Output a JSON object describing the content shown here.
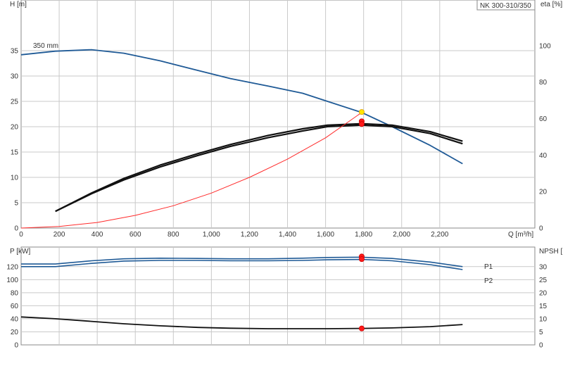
{
  "title_box": "NK 300-310/350",
  "colors": {
    "head": "#1f5a96",
    "eff": "#111111",
    "p": "#1f5a96",
    "npsh": "#111111",
    "system": "#ff2a2a",
    "grid": "#c9c9c9",
    "marker_red": "#ff1a1a",
    "marker_yellow": "#ffe600"
  },
  "chart_data": [
    {
      "type": "line",
      "title": "",
      "xlabel": "Q [m³/h]",
      "ylabel": "H [m]",
      "y2label": "eta [%]",
      "xlim": [
        0,
        2700
      ],
      "ylim": [
        0,
        45
      ],
      "y2lim": [
        0,
        125
      ],
      "x_ticks": [
        0,
        200,
        400,
        600,
        800,
        1000,
        1200,
        1400,
        1600,
        1800,
        2000,
        2200
      ],
      "x_tick_labels": [
        "0",
        "200",
        "400",
        "600",
        "800",
        "1,000",
        "1,200",
        "1,400",
        "1,600",
        "1,800",
        "2,000",
        "2,200"
      ],
      "y_ticks": [
        0,
        5,
        10,
        15,
        20,
        25,
        30,
        35
      ],
      "y2_ticks": [
        0,
        20,
        40,
        60,
        80,
        100
      ],
      "grid": true,
      "annotations": [
        {
          "text": "350 mm",
          "x": 100,
          "y": 36
        }
      ],
      "series": [
        {
          "key": "head",
          "axis": "left",
          "x": [
            0,
            180,
            370,
            540,
            730,
            930,
            1100,
            1300,
            1480,
            1610,
            1790,
            1950,
            2150,
            2320
          ],
          "y": [
            34.2,
            34.9,
            35.2,
            34.5,
            33.0,
            31.1,
            29.5,
            28.0,
            26.6,
            25.0,
            22.8,
            20.0,
            16.3,
            12.7
          ]
        },
        {
          "key": "eff",
          "axis": "right",
          "x": [
            180,
            370,
            540,
            730,
            930,
            1100,
            1300,
            1480,
            1610,
            1790,
            1950,
            2150,
            2320
          ],
          "y": [
            9.2,
            19.2,
            27.2,
            34.5,
            40.8,
            45.8,
            50.8,
            54.4,
            56.4,
            57.2,
            56.4,
            52.8,
            47.6
          ]
        },
        {
          "key": "eff2",
          "axis": "right",
          "x": [
            180,
            370,
            540,
            730,
            930,
            1100,
            1300,
            1480,
            1610,
            1790,
            1950,
            2150,
            2320
          ],
          "y": [
            9.2,
            18.8,
            26.4,
            33.5,
            39.8,
            44.8,
            49.6,
            53.2,
            55.6,
            56.4,
            55.6,
            51.8,
            46.2
          ]
        },
        {
          "key": "system",
          "axis": "left",
          "x": [
            0,
            200,
            400,
            600,
            800,
            1000,
            1200,
            1400,
            1600,
            1790
          ],
          "y": [
            0,
            0.3,
            1.1,
            2.5,
            4.4,
            6.9,
            10.0,
            13.6,
            17.8,
            22.8
          ]
        }
      ],
      "markers": [
        {
          "x": 1790,
          "y": 22.9,
          "axis": "left",
          "color": "yellow"
        },
        {
          "x": 1790,
          "y": 58.5,
          "axis": "right",
          "color": "red"
        },
        {
          "x": 1790,
          "y": 57.0,
          "axis": "right",
          "color": "red"
        }
      ]
    },
    {
      "type": "line",
      "title": "",
      "ylabel": "P [kW]",
      "y2label": "NPSH [m]",
      "xlim": [
        0,
        2700
      ],
      "ylim": [
        0,
        150
      ],
      "y2lim": [
        0,
        37.5
      ],
      "y_ticks": [
        0,
        20,
        40,
        60,
        80,
        100,
        120
      ],
      "y2_ticks": [
        0,
        5,
        10,
        15,
        20,
        25,
        30
      ],
      "grid": true,
      "series": [
        {
          "key": "p1",
          "name": "P1",
          "axis": "left",
          "x": [
            0,
            180,
            370,
            540,
            730,
            930,
            1100,
            1300,
            1480,
            1610,
            1790,
            1950,
            2150,
            2320
          ],
          "y": [
            124,
            124,
            129,
            132,
            133,
            132.5,
            132,
            132,
            133,
            134,
            134.5,
            132.5,
            127,
            120
          ]
        },
        {
          "key": "p2",
          "name": "P2",
          "axis": "left",
          "x": [
            0,
            180,
            370,
            540,
            730,
            930,
            1100,
            1300,
            1480,
            1610,
            1790,
            1950,
            2150,
            2320
          ],
          "y": [
            120,
            120,
            125,
            128.5,
            129.5,
            129.5,
            129,
            129,
            129.5,
            130.5,
            131,
            129,
            123,
            115.5
          ]
        },
        {
          "key": "npsh",
          "axis": "right",
          "x": [
            0,
            180,
            370,
            540,
            730,
            930,
            1100,
            1300,
            1480,
            1610,
            1790,
            1950,
            2150,
            2320
          ],
          "y": [
            10.7,
            10.0,
            9.0,
            8.1,
            7.3,
            6.7,
            6.4,
            6.2,
            6.2,
            6.2,
            6.3,
            6.5,
            7.0,
            7.8
          ]
        }
      ],
      "markers": [
        {
          "x": 1790,
          "y": 135.5,
          "axis": "left",
          "color": "red"
        },
        {
          "x": 1790,
          "y": 131.5,
          "axis": "left",
          "color": "red"
        },
        {
          "x": 1790,
          "y": 6.3,
          "axis": "right",
          "color": "red"
        }
      ]
    }
  ]
}
